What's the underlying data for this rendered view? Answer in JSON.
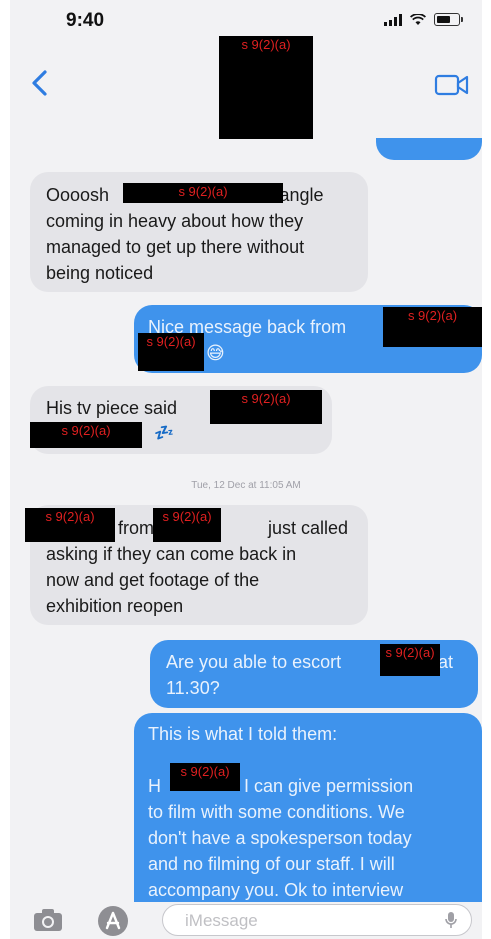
{
  "status_bar": {
    "time": "9:40"
  },
  "redaction_label": "s 9(2)(a)",
  "thread": {
    "messages": [
      {
        "from": "incoming",
        "lines": [
          "Oooosh",
          "'s angle",
          "coming in heavy about how they",
          "managed to get up there without",
          "being noticed"
        ]
      },
      {
        "from": "outgoing",
        "lines": [
          "Nice message back from",
          "😅"
        ]
      },
      {
        "from": "incoming",
        "lines": [
          "His tv piece said",
          "💤"
        ]
      },
      {
        "from": "incoming",
        "lines": [
          "from",
          "just called",
          "asking if they can come back in",
          "now and get footage of the",
          "exhibition reopen"
        ]
      },
      {
        "from": "outgoing",
        "lines": [
          "Are you able to escort",
          "at",
          "11.30?"
        ]
      },
      {
        "from": "outgoing",
        "lines": [
          "This is what I told them:",
          "H",
          "I can give permission",
          "to film with some conditions. We",
          "don't have a spokesperson today",
          "and no filming of our staff. I will",
          "accompany you. Ok to interview"
        ]
      }
    ],
    "timestamp": "Tue, 12 Dec at 11:05 AM"
  },
  "input_bar": {
    "placeholder": "iMessage"
  },
  "icons": [
    "back-chevron-icon",
    "video-camera-icon",
    "camera-icon",
    "app-store-icon",
    "microphone-icon"
  ],
  "colors": {
    "outgoing_bubble": "#3f93ec",
    "incoming_bubble": "#e4e4e8",
    "accent": "#2f7de1",
    "redaction_text": "#e02020"
  }
}
